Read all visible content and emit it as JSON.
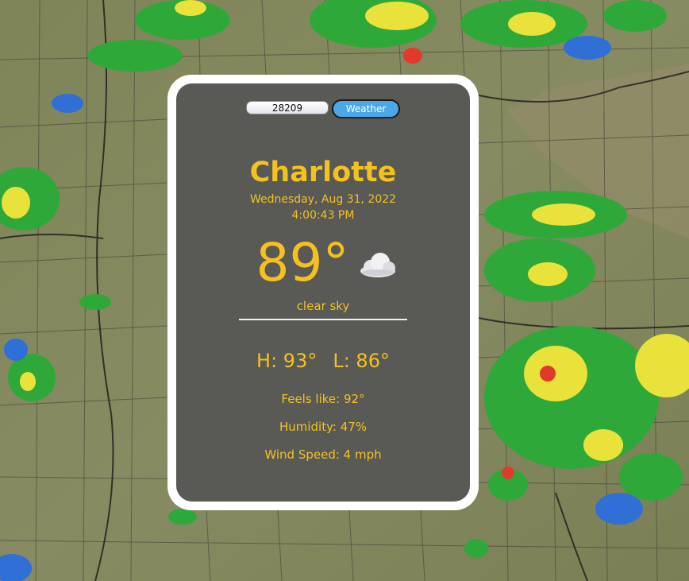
{
  "search": {
    "zip_value": "28209",
    "button_label": "Weather"
  },
  "weather": {
    "city": "Charlotte",
    "date": "Wednesday, Aug 31, 2022",
    "time": "4:00:43 PM",
    "temperature": "89°",
    "condition_icon": "cloud-icon",
    "description": "clear sky",
    "high": "H: 93°",
    "low": "L: 86°",
    "feels_like": "Feels like: 92°",
    "humidity": "Humidity: 47%",
    "wind_speed": "Wind Speed: 4 mph"
  },
  "colors": {
    "accent_text": "#f4c21f",
    "button_bg": "#4aa8e8",
    "card_border": "#ffffff"
  }
}
